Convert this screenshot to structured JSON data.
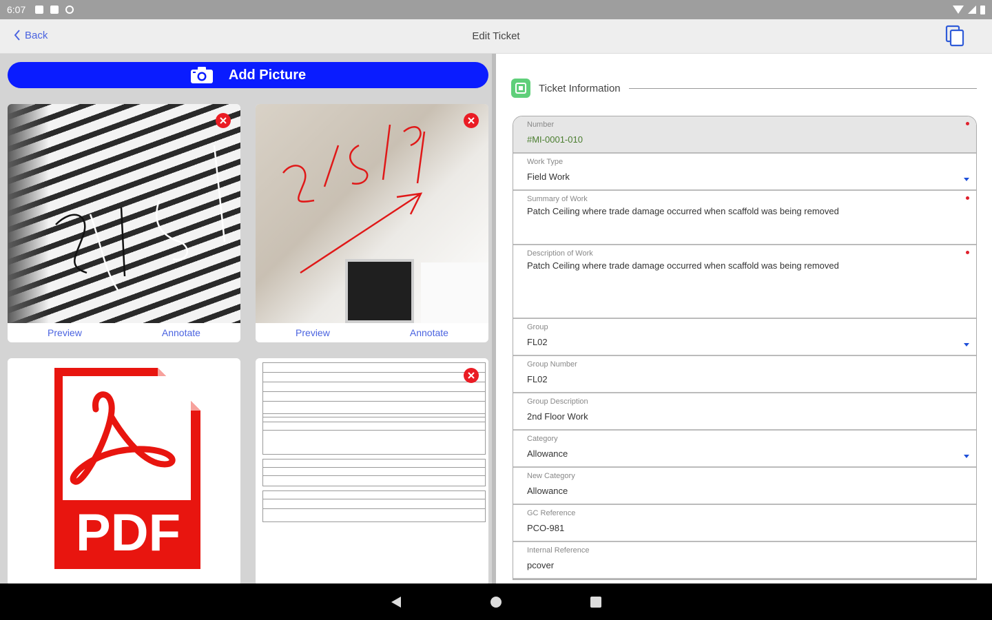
{
  "status_bar": {
    "time": "6:07"
  },
  "app_bar": {
    "back_label": "Back",
    "title": "Edit Ticket"
  },
  "left": {
    "add_picture_label": "Add Picture",
    "cards": [
      {
        "preview": "Preview",
        "annotate": "Annotate",
        "annotation_text": "2/5/19"
      },
      {
        "preview": "Preview",
        "annotate": "Annotate",
        "annotation_text": "2/5/19"
      }
    ],
    "pdf_label": "PDF"
  },
  "right": {
    "section_title": "Ticket Information",
    "fields": [
      {
        "label": "Number",
        "value": "#MI-0001-010"
      },
      {
        "label": "Work Type",
        "value": "Field Work"
      },
      {
        "label": "Summary of Work",
        "value": "Patch Ceiling where trade damage occurred when scaffold was being removed"
      },
      {
        "label": "Description of Work",
        "value": "Patch Ceiling where trade damage occurred when scaffold was being removed"
      },
      {
        "label": "Group",
        "value": "FL02"
      },
      {
        "label": "Group Number",
        "value": "FL02"
      },
      {
        "label": "Group Description",
        "value": "2nd Floor Work"
      },
      {
        "label": "Category",
        "value": "Allowance"
      },
      {
        "label": "New Category",
        "value": "Allowance"
      },
      {
        "label": "GC Reference",
        "value": "PCO-981"
      },
      {
        "label": "Internal Reference",
        "value": "pcover"
      }
    ]
  },
  "colors": {
    "primary": "#0a1cff",
    "link": "#4a63e0",
    "required": "#e0202c",
    "remove": "#ea1c24",
    "section_badge": "#5fcf7a"
  }
}
